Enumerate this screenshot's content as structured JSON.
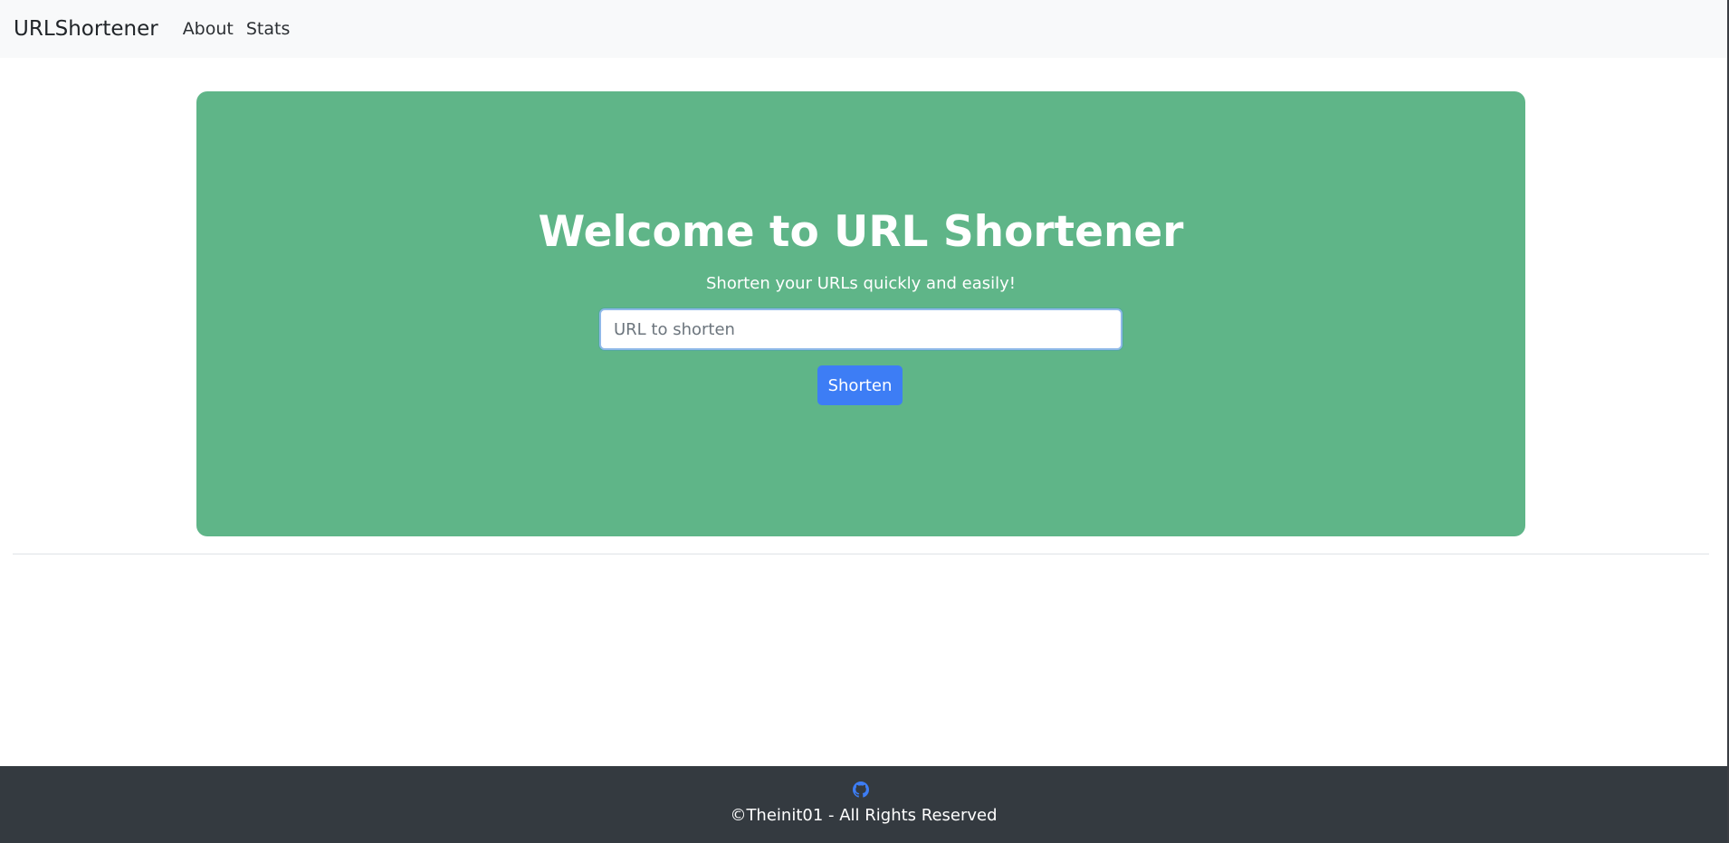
{
  "navbar": {
    "brand": "URLShortener",
    "links": [
      {
        "label": "About"
      },
      {
        "label": "Stats"
      }
    ]
  },
  "hero": {
    "title": "Welcome to URL Shortener",
    "subtitle": "Shorten your URLs quickly and easily!",
    "input_placeholder": "URL to shorten",
    "input_value": "",
    "button_label": "Shorten",
    "background_color": "#5fb588"
  },
  "footer": {
    "icon": "github-icon",
    "copyright": "©Theinit01 - All Rights Reserved",
    "background_color": "#343a40",
    "icon_color": "#3d7df5"
  }
}
